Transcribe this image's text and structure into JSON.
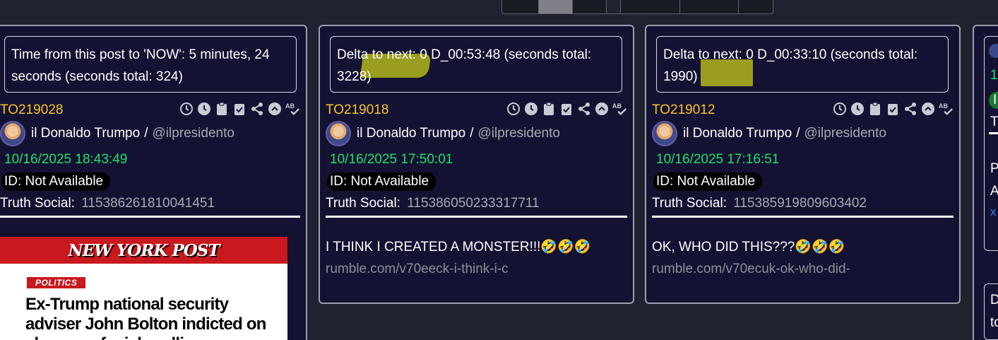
{
  "top_tabs": {
    "segments": 7
  },
  "cards": [
    {
      "delta_text": "Time from this post to 'NOW': 5 minutes, 24 seconds   (seconds total: 324)",
      "id": "TO219028",
      "author_name": "il Donaldo Trumpo",
      "author_sep": "/",
      "author_handle": "@ilpresidento",
      "datetime": "10/16/2025 18:43:49",
      "id_label": "ID: Not Available",
      "truth_label": "Truth Social:",
      "truth_id": "115386261810041451",
      "embed": {
        "logo": "NEW YORK POST",
        "section": "POLITICS",
        "headline": "Ex-Trump national security adviser John Bolton indicted on charges of mishandling"
      }
    },
    {
      "delta_text": "Delta to next: 0 D_00:53:48 (seconds total: 3228)",
      "id": "TO219018",
      "author_name": "il Donaldo Trumpo",
      "author_sep": "/",
      "author_handle": "@ilpresidento",
      "datetime": "10/16/2025 17:50:01",
      "id_label": "ID: Not Available",
      "truth_label": "Truth Social:",
      "truth_id": "115386050233317711",
      "content": "I THINK I CREATED A MONSTER!!!🤣🤣🤣",
      "link": "rumble.com/v70eeck-i-think-i-c"
    },
    {
      "delta_text": "Delta to next: 0 D_00:33:10 (seconds total: 1990)",
      "id": "TO219012",
      "author_name": "il Donaldo Trumpo",
      "author_sep": "/",
      "author_handle": "@ilpresidento",
      "datetime": "10/16/2025 17:16:51",
      "id_label": "ID: Not Available",
      "truth_label": "Truth Social:",
      "truth_id": "115385919809603402",
      "content": "OK, WHO DID THIS???🤣🤣🤣",
      "link": "rumble.com/v70ecuk-ok-who-did-"
    }
  ],
  "partial_card": {
    "date_fragment": "1",
    "id_fragment": "I",
    "truth_fragment": "T",
    "content_fragment_1": "P",
    "content_fragment_2": "A",
    "link_fragment": "x",
    "delta_fragment_1": "D",
    "delta_fragment_2": "to"
  },
  "colors": {
    "background": "#202230",
    "card_bg": "#141232",
    "id_color": "#f7c328",
    "date_color": "#22e06a",
    "muted": "#a7a9b3",
    "highlight": "#b2b61c"
  },
  "icon_names": [
    "history-icon",
    "clock-icon",
    "clipboard-icon",
    "clipboard-check-icon",
    "share-icon",
    "chevron-up-circle-icon",
    "spellcheck-icon"
  ]
}
